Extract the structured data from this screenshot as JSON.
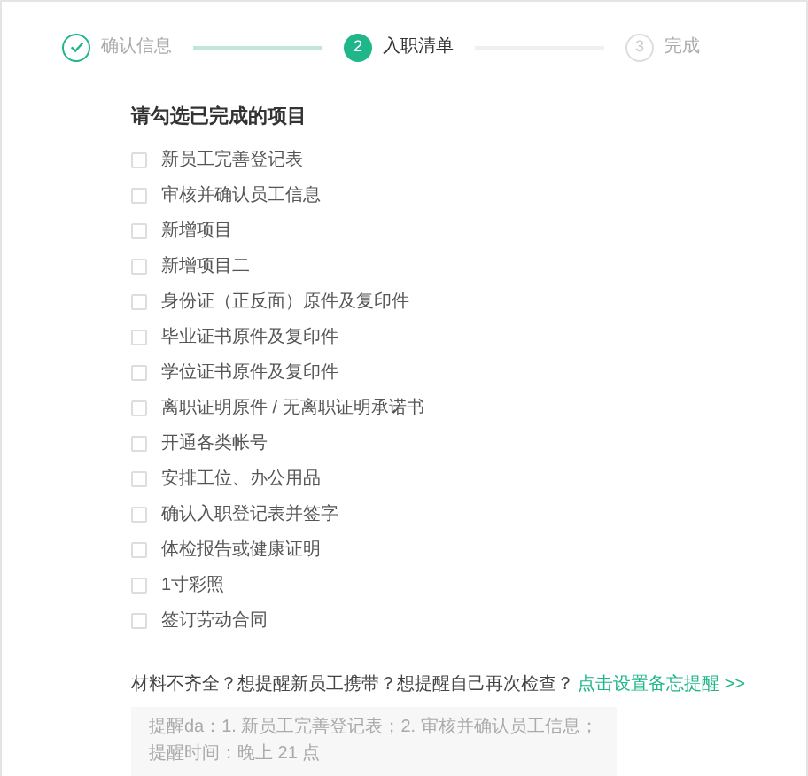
{
  "steps": [
    {
      "label": "确认信息",
      "kind": "done"
    },
    {
      "number": "2",
      "label": "入职清单",
      "kind": "active"
    },
    {
      "number": "3",
      "label": "完成",
      "kind": "pending"
    }
  ],
  "checklist": {
    "title": "请勾选已完成的项目",
    "items": [
      {
        "label": "新员工完善登记表",
        "checked": false
      },
      {
        "label": "审核并确认员工信息",
        "checked": false
      },
      {
        "label": "新增项目",
        "checked": false
      },
      {
        "label": "新增项目二",
        "checked": false
      },
      {
        "label": "身份证（正反面）原件及复印件",
        "checked": false
      },
      {
        "label": "毕业证书原件及复印件",
        "checked": false
      },
      {
        "label": "学位证书原件及复印件",
        "checked": false
      },
      {
        "label": "离职证明原件 / 无离职证明承诺书",
        "checked": false
      },
      {
        "label": "开通各类帐号",
        "checked": false
      },
      {
        "label": "安排工位、办公用品",
        "checked": false
      },
      {
        "label": "确认入职登记表并签字",
        "checked": false
      },
      {
        "label": "体检报告或健康证明",
        "checked": false
      },
      {
        "label": "1寸彩照",
        "checked": false
      },
      {
        "label": "签订劳动合同",
        "checked": false
      }
    ]
  },
  "reminder": {
    "question": "材料不齐全？想提醒新员工携带？想提醒自己再次检查？",
    "link": "点击设置备忘提醒 >>",
    "lines": [
      "提醒da：1. 新员工完善登记表；2. 审核并确认员工信息；",
      "提醒时间：晚上 21 点"
    ]
  }
}
